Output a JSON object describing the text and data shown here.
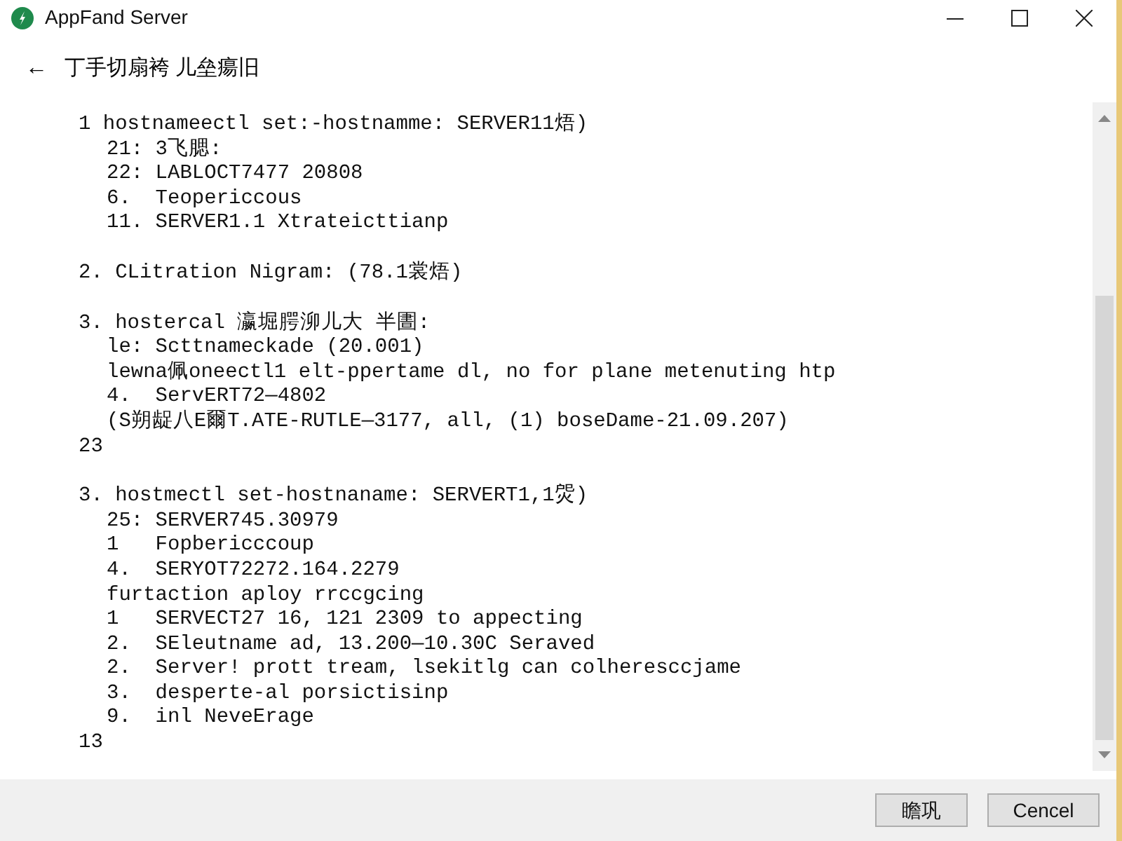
{
  "window": {
    "title": "AppFand Server"
  },
  "header": {
    "back": "←",
    "title": "丁手切扇袴 儿垒瘍旧"
  },
  "blocks": [
    {
      "text": "1 hostnameectl set:-hostnamme: SERVER11焐)",
      "children": [
        {
          "text": "21: 3飞腮:"
        },
        {
          "text": "22: LABLOCT7477 20808"
        },
        {
          "text": "6.  Teopericcous"
        },
        {
          "text": "11. SERVER1.1 Xtrateicttianp"
        }
      ]
    },
    {
      "text": "2. CLitration Nigram: (78.1裳焐)"
    },
    {
      "text": "3. hostercal 瀛堀腭泖儿大 半圕:",
      "children": [
        {
          "text": "le: Scttnameckade (20.001)"
        },
        {
          "text": "lewna佩oneectl1 elt-ppertame dl, no for plane metenuting htp"
        },
        {
          "text": "4.  ServERT72—4802"
        },
        {
          "text": "(S朔龊八E爾T.ATE-RUTLE—3177, all, (1) boseDame-21.09.207)"
        }
      ],
      "end": "23"
    },
    {
      "text": "3. hostmectl set-hostnaname: SERVERT1,1焈)",
      "children": [
        {
          "text": "25: SERVER745.30979"
        },
        {
          "text": "1   Fopbericccoup"
        },
        {
          "text": "4.  SERYOT72272.164.2279"
        },
        {
          "text": "furtaction aploy rrccgcing"
        },
        {
          "text": "1   SERVECT27 16, 121 2309 to appecting"
        },
        {
          "text": "2.  SEleutname ad, 13.200—10.30C Seraved"
        },
        {
          "text": "2.  Server! prott tream, lsekitlg can colheresccjame"
        },
        {
          "text": "3.  desperte-al porsictisinp"
        },
        {
          "text": "9.  inl NeveErage"
        }
      ],
      "end": "13"
    }
  ],
  "buttons": [
    {
      "label": "瞻巩",
      "kind": "ok"
    },
    {
      "label": "Cencel",
      "kind": "cancel"
    }
  ]
}
